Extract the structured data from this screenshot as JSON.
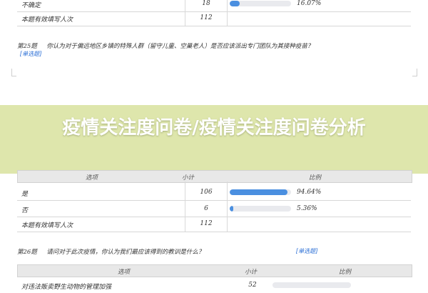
{
  "banner": {
    "title": "疫情关注度问卷/疫情关注度问卷分析"
  },
  "top_table": {
    "rows": [
      {
        "option": "不确定",
        "count": "18",
        "percent": "16.07%",
        "fill": 0.1607
      },
      {
        "option": "本题有效填写人次",
        "count": "112"
      }
    ]
  },
  "q25": {
    "number": "第25题",
    "question": "你认为对于偏远地区乡镇的特殊人群（留守儿童、空巢老人）是否应该派出专门团队为其接种疫苗？",
    "tag": "[单选题]"
  },
  "q25_table": {
    "headers": {
      "option": "选项",
      "count": "小计",
      "ratio": "比例"
    },
    "rows": [
      {
        "option": "是",
        "count": "106",
        "percent": "94.64%",
        "fill": 0.9464
      },
      {
        "option": "否",
        "count": "6",
        "percent": "5.36%",
        "fill": 0.0536
      },
      {
        "option": "本题有效填写人次",
        "count": "112"
      }
    ]
  },
  "q26": {
    "number": "第26题",
    "question": "请问对于此次疫情，你认为我们最应该得到的教训是什么？",
    "tag": "[单选题]"
  },
  "q26_table": {
    "headers": {
      "option": "选项",
      "count": "小计",
      "ratio": "比例"
    },
    "rows": [
      {
        "option": "对违法贩卖野生动物的管理加强",
        "count": "52"
      }
    ]
  },
  "colors": {
    "bar_fill": "#4a8fe0",
    "bar_track": "#e9eaee",
    "banner": "#d8e29e",
    "link": "#2b6fd6"
  }
}
